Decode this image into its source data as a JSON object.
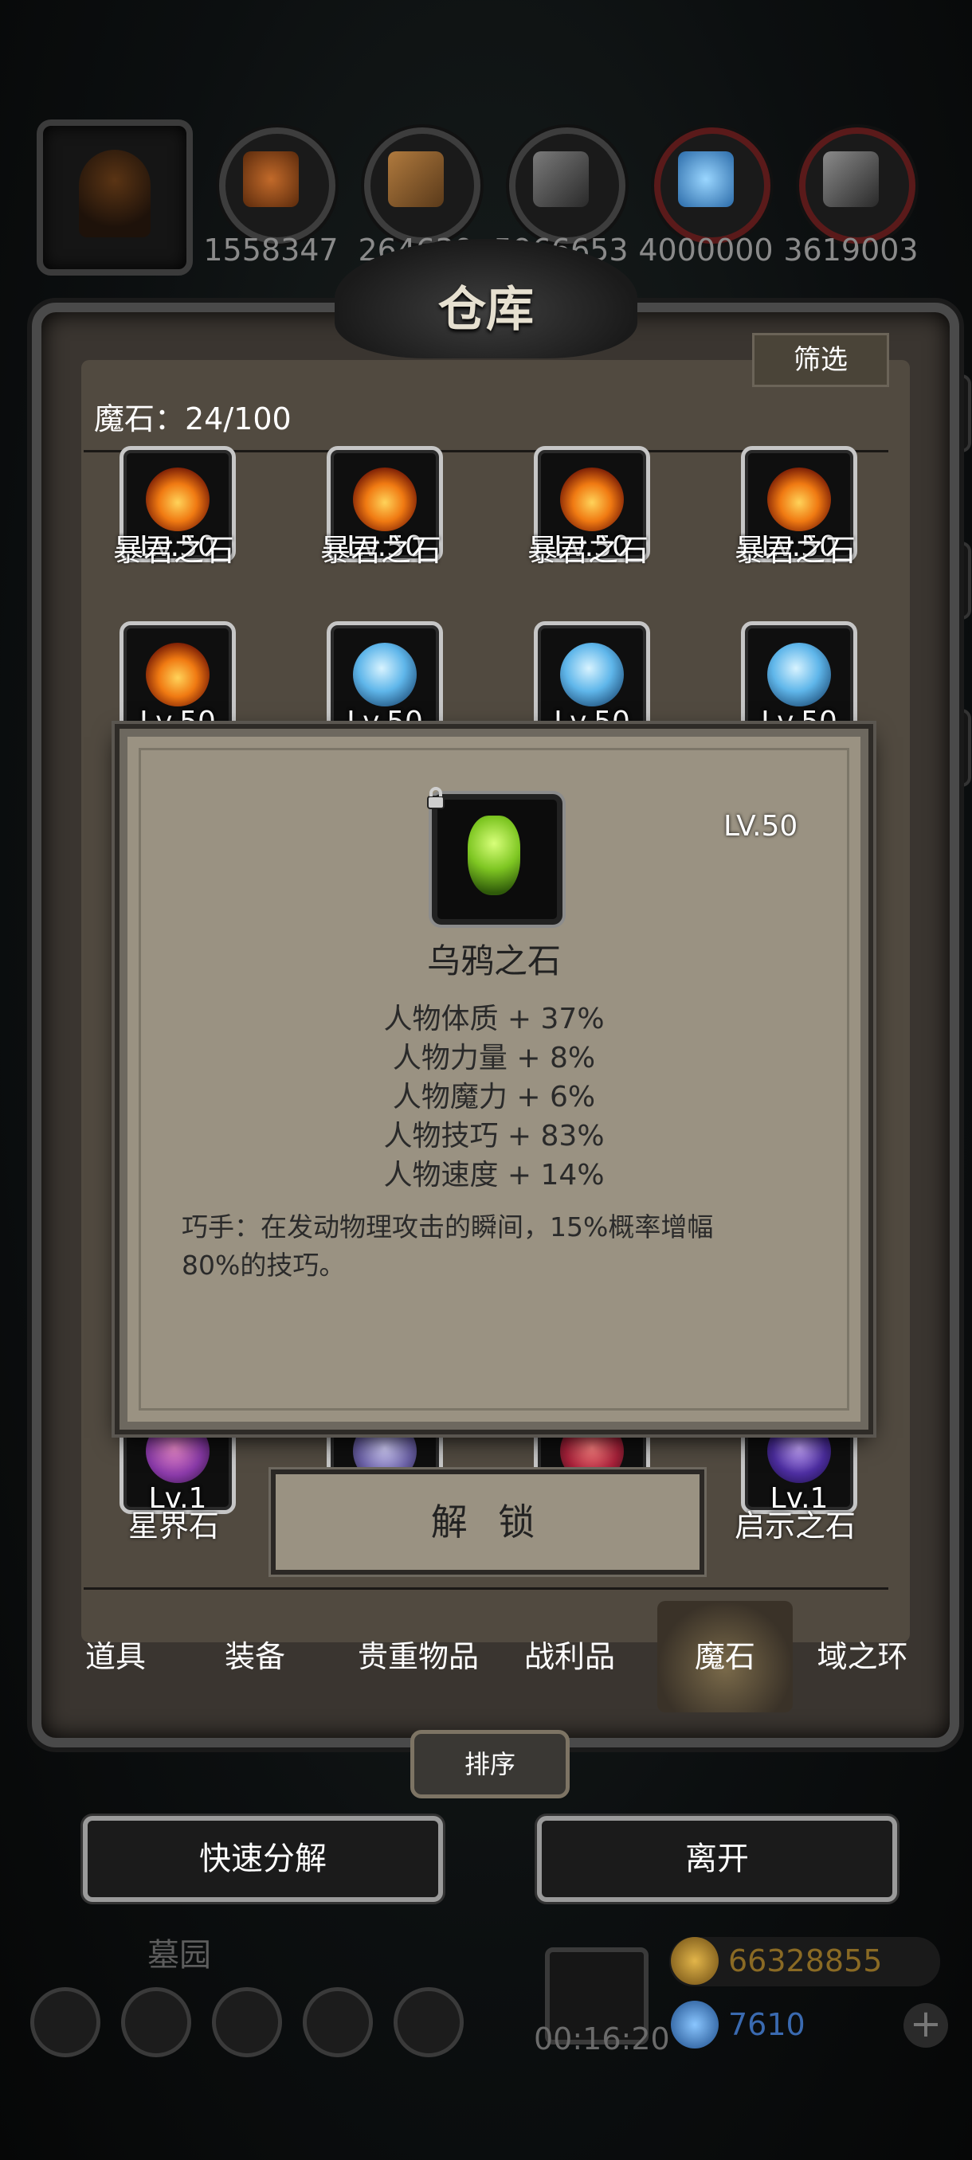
{
  "resources": [
    {
      "icon": "bread-icon",
      "value": "1558347",
      "color": "#a1521f"
    },
    {
      "icon": "wood-icon",
      "value": "264639",
      "color": "#8a6331"
    },
    {
      "icon": "stone-icon",
      "value": "5966653",
      "color": "#5a5a5a"
    },
    {
      "icon": "blue-crystal-icon",
      "value": "4000000",
      "color": "#4a9ad8"
    },
    {
      "icon": "iron-icon",
      "value": "3619003",
      "color": "#6a6a6a"
    }
  ],
  "panel": {
    "title": "仓库",
    "filter_label": "筛选",
    "count_label": "魔石：24/100"
  },
  "grid": {
    "row1": [
      {
        "name": "暴君之石",
        "lv": "Lv.50",
        "type": "fire"
      },
      {
        "name": "暴君之石",
        "lv": "Lv.50",
        "type": "fire"
      },
      {
        "name": "暴君之石",
        "lv": "Lv.50",
        "type": "fire"
      },
      {
        "name": "暴君之石",
        "lv": "Lv.50",
        "type": "fire"
      }
    ],
    "row2": [
      {
        "lv": "Lv.50",
        "type": "fire"
      },
      {
        "lv": "Lv.50",
        "type": "ice"
      },
      {
        "lv": "Lv.50",
        "type": "ice"
      },
      {
        "lv": "Lv.50",
        "type": "ice"
      }
    ],
    "last_row": [
      {
        "name": "星界石",
        "lv": "Lv.1",
        "type": "astral"
      },
      {
        "name": "",
        "lv": "",
        "type": "crystal"
      },
      {
        "name": "",
        "lv": "",
        "type": "red"
      },
      {
        "name": "启示之石",
        "lv": "Lv.1",
        "type": "violet"
      }
    ],
    "partial_glyph_1": "石",
    "partial_glyph_2": "石"
  },
  "popup": {
    "level": "LV.50",
    "name": "乌鸦之石",
    "stats": [
      "人物体质 + 37%",
      "人物力量 + 8%",
      "人物魔力 + 6%",
      "人物技巧 + 83%",
      "人物速度 + 14%"
    ],
    "description": "巧手：在发动物理攻击的瞬间，15%概率增幅80%的技巧。"
  },
  "unlock_label": "解 锁",
  "tabs": [
    {
      "label": "道具"
    },
    {
      "label": "装备"
    },
    {
      "label": "贵重物品"
    },
    {
      "label": "战利品"
    },
    {
      "label": "魔石",
      "active": true
    },
    {
      "label": "域之环"
    }
  ],
  "sort_label": "排序",
  "quick_decompose_label": "快速分解",
  "leave_label": "离开",
  "hud": {
    "location": "墓园",
    "timer": "00:16:20",
    "gold": "66328855",
    "gems": "7610",
    "gold_color": "#b8892a",
    "gem_color": "#3a7ab8"
  }
}
